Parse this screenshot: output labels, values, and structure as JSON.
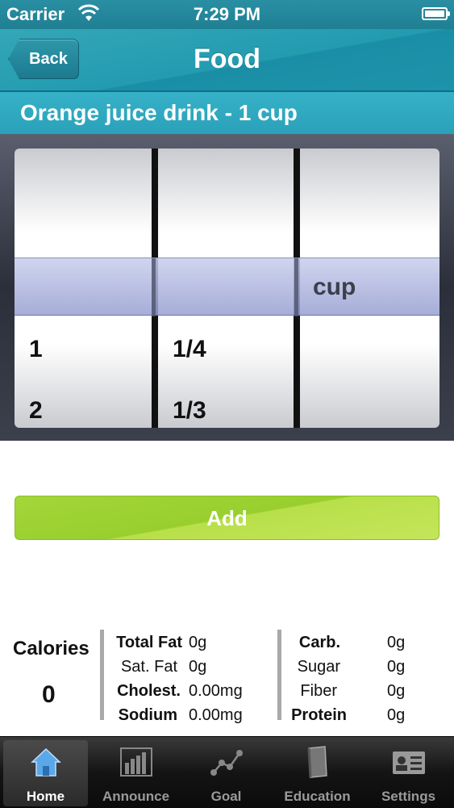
{
  "status_bar": {
    "carrier": "Carrier",
    "time": "7:29 PM"
  },
  "nav": {
    "back_label": "Back",
    "title": "Food"
  },
  "item_header": "Orange juice drink - 1 cup",
  "picker": {
    "wheel1": [
      "1",
      "2"
    ],
    "wheel2": [
      "1/4",
      "1/3"
    ],
    "unit": "cup"
  },
  "add_button": "Add",
  "nutrition": {
    "calories_label": "Calories",
    "calories_value": "0",
    "rows_left": [
      {
        "label": "Total Fat",
        "value": "0g",
        "bold": true
      },
      {
        "label": "Sat. Fat",
        "value": "0g",
        "bold": false
      },
      {
        "label": "Cholest.",
        "value": "0.00mg",
        "bold": true
      },
      {
        "label": "Sodium",
        "value": "0.00mg",
        "bold": true
      }
    ],
    "rows_right": [
      {
        "label": "Carb.",
        "value": "0g",
        "bold": true
      },
      {
        "label": "Sugar",
        "value": "0g",
        "bold": false
      },
      {
        "label": "Fiber",
        "value": "0g",
        "bold": false
      },
      {
        "label": "Protein",
        "value": "0g",
        "bold": true
      }
    ]
  },
  "tab_bar": {
    "tabs": [
      {
        "label": "Home",
        "icon": "home-icon",
        "active": true
      },
      {
        "label": "Announce",
        "icon": "bar-chart-icon",
        "active": false
      },
      {
        "label": "Goal",
        "icon": "line-chart-icon",
        "active": false
      },
      {
        "label": "Education",
        "icon": "book-icon",
        "active": false
      },
      {
        "label": "Settings",
        "icon": "id-card-icon",
        "active": false
      }
    ]
  },
  "colors": {
    "accent": "#239bb0",
    "add_green": "#a4d63a",
    "tab_bar": "#141414"
  }
}
